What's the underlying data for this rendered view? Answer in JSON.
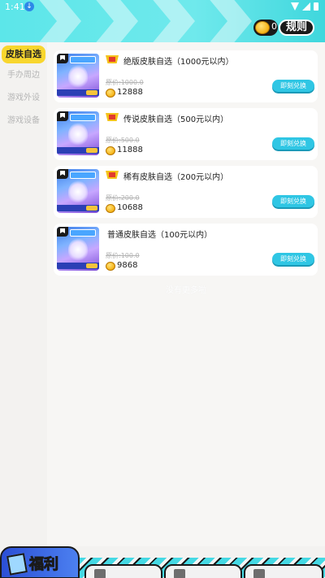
{
  "status_bar": {
    "time": "1:41",
    "download_icon": "download-icon",
    "icons": [
      "wifi-icon",
      "signal-icon",
      "battery-icon"
    ]
  },
  "header": {
    "coin_count": "0",
    "rules_label": "规则"
  },
  "sidebar": {
    "items": [
      {
        "label": "皮肤自选",
        "active": true
      },
      {
        "label": "手办周边",
        "active": false
      },
      {
        "label": "游戏外设",
        "active": false
      },
      {
        "label": "游戏设备",
        "active": false
      }
    ]
  },
  "cards": [
    {
      "title": "绝版皮肤自选（1000元以内）",
      "original_price": "原价:1000.0",
      "price": "12888",
      "button": "即刻兑换"
    },
    {
      "title": "传说皮肤自选（500元以内）",
      "original_price": "原价:500.0",
      "price": "11888",
      "button": "即刻兑换"
    },
    {
      "title": "稀有皮肤自选（200元以内）",
      "original_price": "原价:200.0",
      "price": "10688",
      "button": "即刻兑换"
    },
    {
      "title": "普通皮肤自选（100元以内）",
      "original_price": "原价:100.0",
      "price": "9868",
      "button": "即刻兑换"
    }
  ],
  "more_text": "没有更多啦",
  "bottom_nav": {
    "welfare_label": "福利"
  },
  "colors": {
    "header": "#5ce6e9",
    "active_tab": "#f8d62e",
    "redeem_button": "#2fc6e4"
  }
}
